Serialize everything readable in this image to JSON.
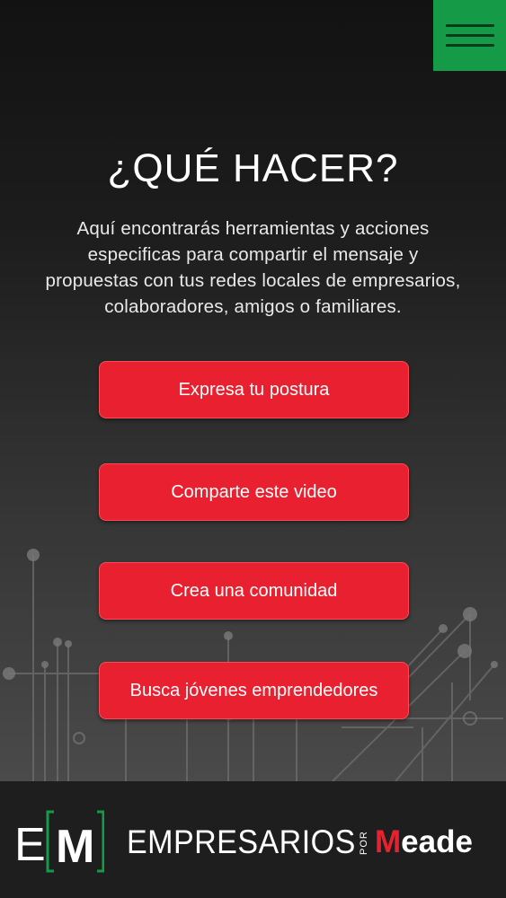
{
  "header": {
    "menu_icon": "hamburger-menu-icon",
    "menu_color": "#159b48"
  },
  "main": {
    "title": "¿QUÉ HACER?",
    "intro": "Aquí encontrarás herramientas y acciones especificas para compartir el mensaje y propuestas con tus redes locales de empresarios, colaboradores, amigos o familiares.",
    "actions": [
      {
        "label": "Expresa tu postura"
      },
      {
        "label": "Comparte este video"
      },
      {
        "label": "Crea una comunidad"
      },
      {
        "label": "Busca jóvenes emprendedores"
      }
    ],
    "accent_color": "#e8202f"
  },
  "footer": {
    "logo_letters": [
      "E",
      "M"
    ],
    "brand_word": "EMPRESARIOS",
    "brand_connector": "POR",
    "brand_name_initial": "M",
    "brand_name_rest": "eade"
  }
}
